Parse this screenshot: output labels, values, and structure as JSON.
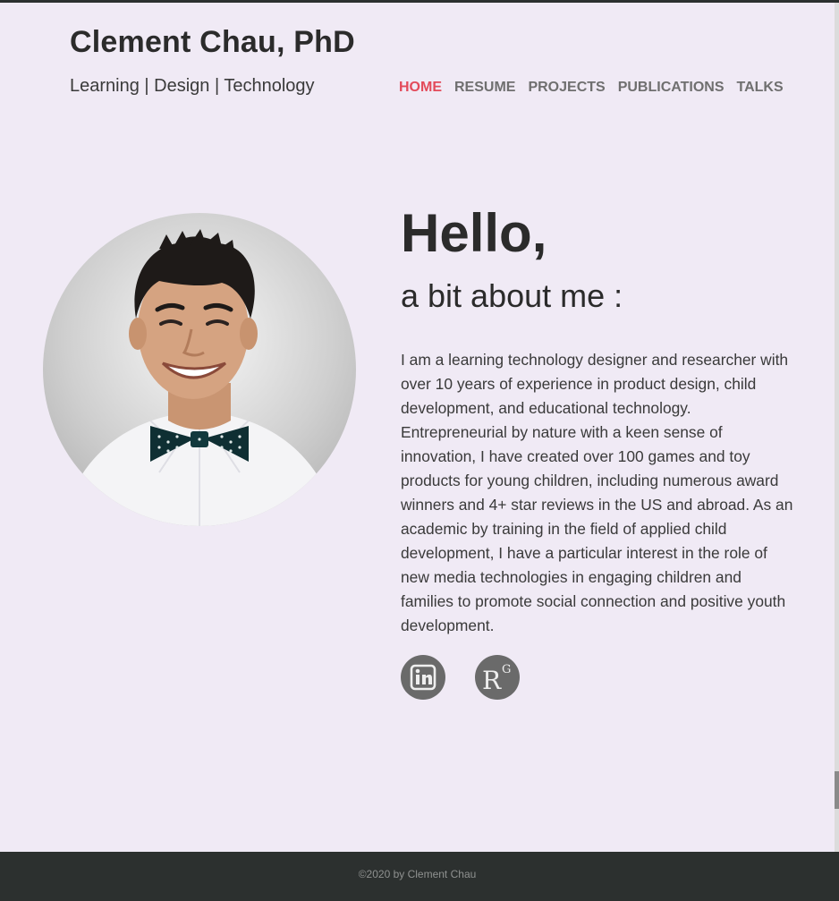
{
  "header": {
    "site_title": "Clement Chau, PhD",
    "tagline": "Learning | Design | Technology"
  },
  "nav": {
    "items": [
      {
        "label": "HOME",
        "active": true
      },
      {
        "label": "RESUME",
        "active": false
      },
      {
        "label": "PROJECTS",
        "active": false
      },
      {
        "label": "PUBLICATIONS",
        "active": false
      },
      {
        "label": "TALKS",
        "active": false
      }
    ]
  },
  "about": {
    "heading": "Hello,",
    "subheading": "a bit about me :",
    "bio": "I am a learning technology designer and researcher with over 10 years of experience in product design, child development, and educational technology. Entrepreneurial by nature with a keen sense of innovation, I have created over 100 games and toy products for young children, including numerous award winners and 4+ star reviews in the US and abroad. As an academic by training in the field of applied child development, I have a particular interest in the role of new media technologies in engaging children and families to promote social connection and positive youth development."
  },
  "social": {
    "linkedin_icon": "linkedin-icon",
    "researchgate_icon": "researchgate-icon",
    "researchgate_glyph_main": "R",
    "researchgate_glyph_sup": "G",
    "linkedin_glyph": "in"
  },
  "footer": {
    "text": "©2020 by Clement Chau"
  },
  "colors": {
    "background": "#f0eaf5",
    "accent": "#e34a5a",
    "nav_text": "#6f6f6f",
    "footer_bg": "#2c302f",
    "icon_bg": "#6a6a6a"
  }
}
